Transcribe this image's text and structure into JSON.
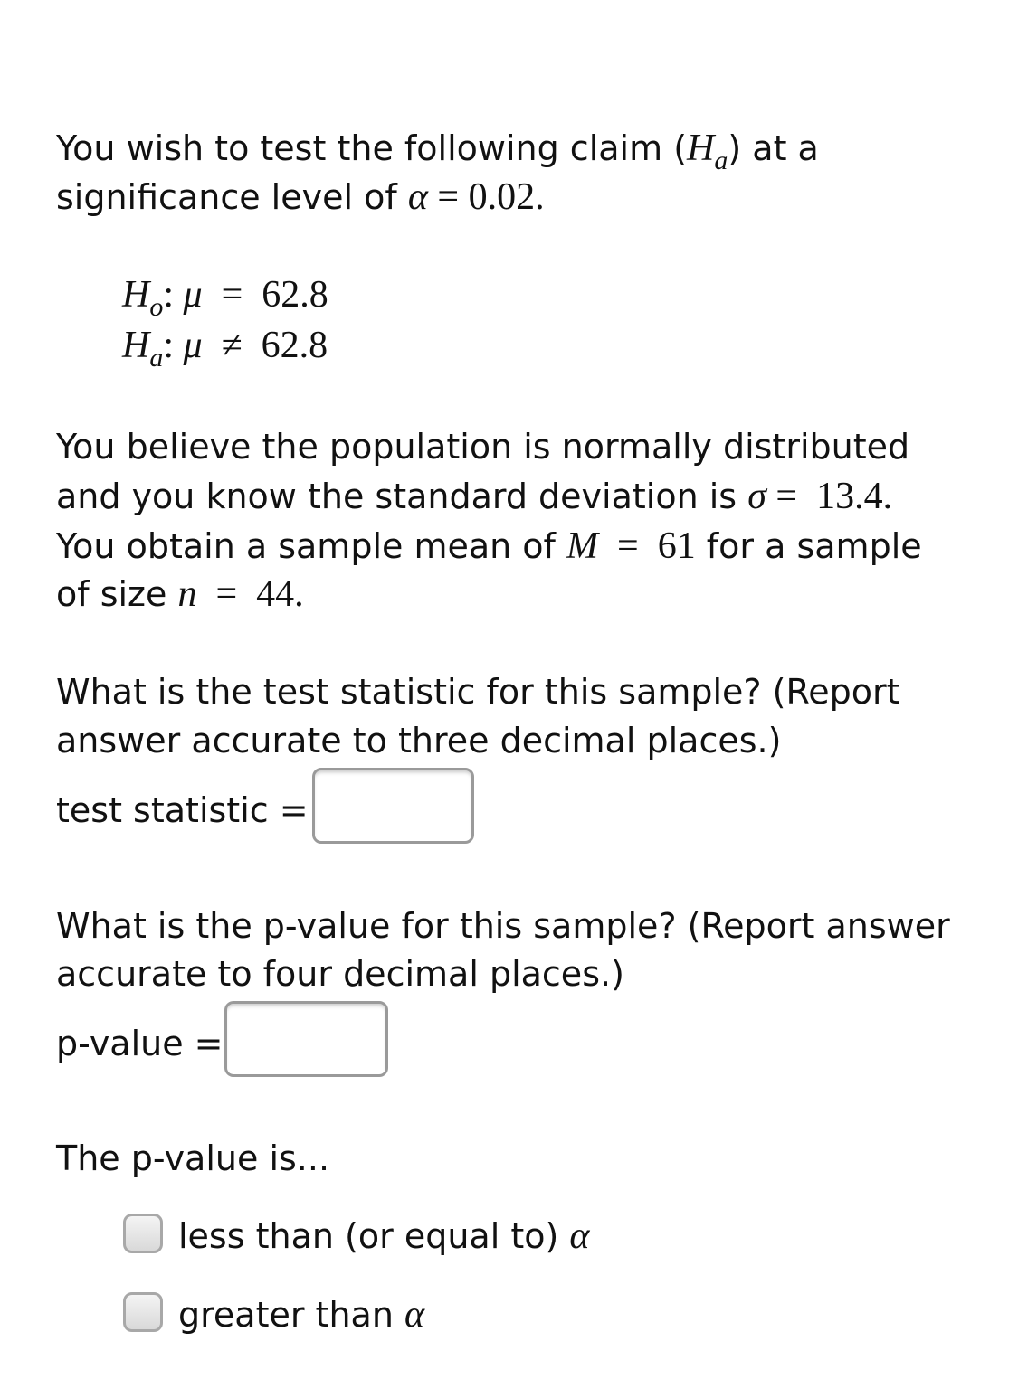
{
  "intro": {
    "line1_text": "You wish to test the following claim (",
    "line1_H": "H",
    "line1_sub": "a",
    "line1_end": ") at a",
    "line2_text": "significance level of ",
    "alpha_symbol": "α",
    "equals": " = ",
    "alpha_value": "0.02."
  },
  "hypotheses": {
    "null": {
      "H": "H",
      "sub": "o",
      "colon": ":",
      "mu": "μ",
      "op": "=",
      "value": "62.8"
    },
    "alt": {
      "H": "H",
      "sub": "a",
      "colon": ":",
      "mu": "μ",
      "op": "≠",
      "value": "62.8"
    }
  },
  "assumptions": {
    "line1": "You believe the population is normally distributed",
    "line2_text": "and you know the standard deviation is ",
    "sigma": "σ",
    "sigma_value": "13.4.",
    "line3_text": "You obtain a sample mean of ",
    "M": "M",
    "M_value": "61",
    "line3_end": " for a sample",
    "line4_text": "of size ",
    "n": "n",
    "n_value": "44."
  },
  "q1": {
    "line1": "What is the test statistic for this sample? (Report",
    "line2": "answer accurate to three decimal places.)",
    "label": "test statistic =",
    "value": ""
  },
  "q2": {
    "line1": "What is the p-value for this sample? (Report answer",
    "line2": "accurate to four decimal places.)",
    "label": "p-value =",
    "value": ""
  },
  "q3": {
    "prompt": "The p-value is...",
    "options": [
      {
        "label": "less than (or equal to) ",
        "symbol": "α",
        "checked": false
      },
      {
        "label": "greater than ",
        "symbol": "α",
        "checked": false
      }
    ]
  }
}
